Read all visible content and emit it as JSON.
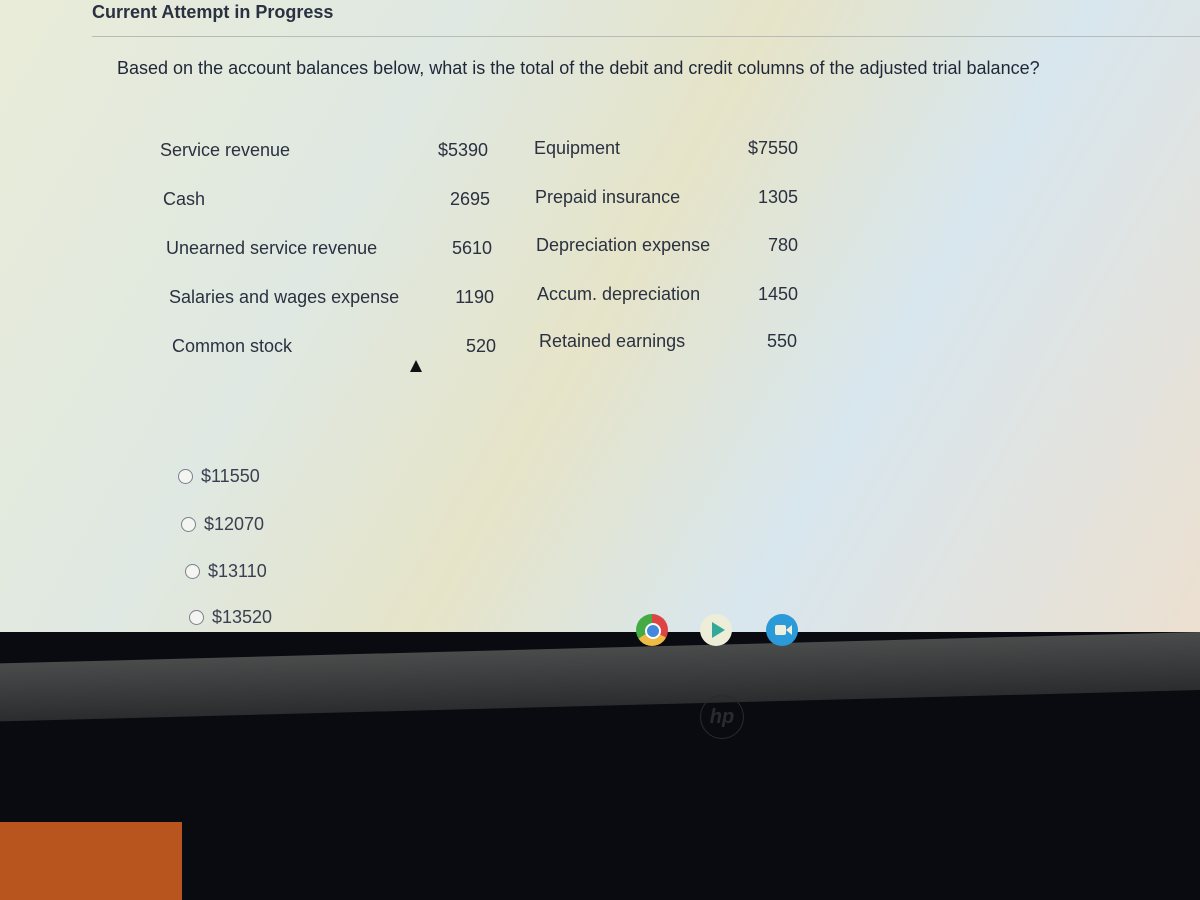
{
  "header": {
    "title": "Current Attempt in Progress"
  },
  "question": "Based on the account balances below, what is the total of the debit and credit columns of the adjusted trial balance?",
  "accounts_left": [
    {
      "name": "Service revenue",
      "amount": "$5390"
    },
    {
      "name": "Cash",
      "amount": "2695"
    },
    {
      "name": "Unearned service revenue",
      "amount": "5610"
    },
    {
      "name": "Salaries and wages expense",
      "amount": "1190"
    },
    {
      "name": "Common stock",
      "amount": "520"
    }
  ],
  "accounts_right": [
    {
      "name": "Equipment",
      "amount": "$7550"
    },
    {
      "name": "Prepaid insurance",
      "amount": "1305"
    },
    {
      "name": "Depreciation expense",
      "amount": "780"
    },
    {
      "name": "Accum. depreciation",
      "amount": "1450"
    },
    {
      "name": "Retained earnings",
      "amount": "550"
    }
  ],
  "options": [
    "$11550",
    "$12070",
    "$13110",
    "$13520"
  ],
  "taskbar": {
    "icons": [
      "chrome-icon",
      "play-store-icon",
      "video-call-icon"
    ]
  },
  "brand_logo": "hp"
}
